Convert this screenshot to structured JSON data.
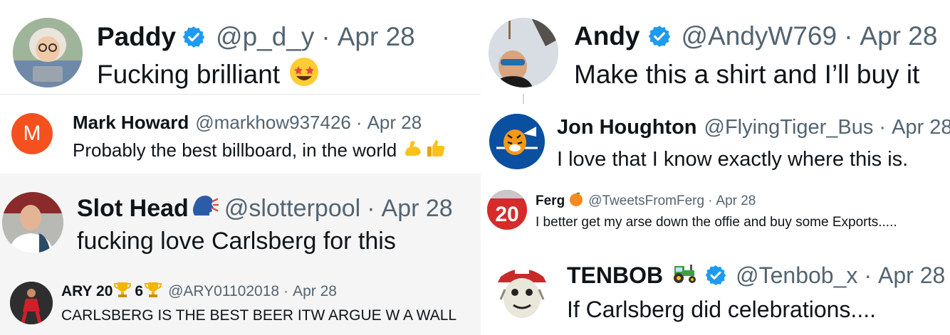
{
  "tweets": [
    {
      "name": "Paddy",
      "handle": "@p_d_y",
      "sep": "·",
      "date": "Apr 28",
      "text": "Fucking brilliant",
      "verified": true,
      "avatar_icon": "cartoon-person-avatar",
      "text_emoji_icon": "star-struck-emoji"
    },
    {
      "name": "Mark Howard",
      "handle": "@markhow937426",
      "sep": "·",
      "date": "Apr 28",
      "text": "Probably the best billboard, in the world",
      "avatar_letter": "M",
      "avatar_color": "#f4511e",
      "text_emoji_icons": [
        "flexed-biceps-emoji",
        "thumbs-up-emoji"
      ]
    },
    {
      "name": "Slot Head",
      "handle": "@slotterpool",
      "sep": "·",
      "date": "Apr 28",
      "text": "fucking love Carlsberg for this",
      "name_emoji_icon": "speaking-head-emoji",
      "avatar_icon": "man-photo-avatar"
    },
    {
      "name": "ARY 20",
      "name_mid": "6",
      "handle": "@ARY01102018",
      "sep": "·",
      "date": "Apr 28",
      "text": "CARLSBERG IS THE BEST BEER ITW ARGUE W A WALL",
      "name_emoji_icon": "trophy-emoji",
      "avatar_icon": "footballer-photo-avatar"
    },
    {
      "name": "Andy",
      "handle": "@AndyW769",
      "sep": "·",
      "date": "Apr 28",
      "text": "Make this a shirt and I’ll buy it",
      "verified": true,
      "avatar_icon": "man-sunglasses-photo-avatar"
    },
    {
      "name": "Jon Houghton",
      "handle": "@FlyingTiger_Bus",
      "sep": "·",
      "date": "Apr 28",
      "text": "I love that I know exactly where this is.",
      "avatar_icon": "flying-tiger-logo-avatar"
    },
    {
      "name": "Ferg",
      "handle": "@TweetsFromFerg",
      "sep": "·",
      "date": "Apr 28",
      "text": "I better get my arse down the offie and buy some Exports.....",
      "name_emoji_icon": "orange-emoji",
      "avatar_icon": "number-20-shirt-avatar"
    },
    {
      "name": "TENBOB",
      "handle": "@Tenbob_x",
      "sep": "·",
      "date": "Apr 28",
      "text": "If Carlsberg did celebrations....",
      "verified": true,
      "name_emoji_icon": "tractor-emoji",
      "avatar_icon": "cartoon-dog-cap-avatar"
    }
  ],
  "colors": {
    "verified_blue": "#1d9bf0",
    "meta_gray": "#536471",
    "name_black": "#0f1419"
  }
}
